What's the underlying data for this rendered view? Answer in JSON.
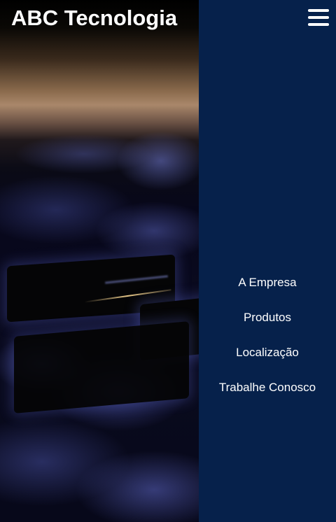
{
  "header": {
    "site_title": "ABC Tecnologia"
  },
  "menu": {
    "toggle_icon": "hamburger-menu-icon",
    "items": [
      {
        "label": "A Empresa"
      },
      {
        "label": "Produtos"
      },
      {
        "label": "Localização"
      },
      {
        "label": "Trabalhe Conosco"
      }
    ]
  },
  "hero": {
    "image": "blurred-keyboard-photo"
  },
  "colors": {
    "nav_background": "#06214b",
    "text": "#ffffff"
  }
}
